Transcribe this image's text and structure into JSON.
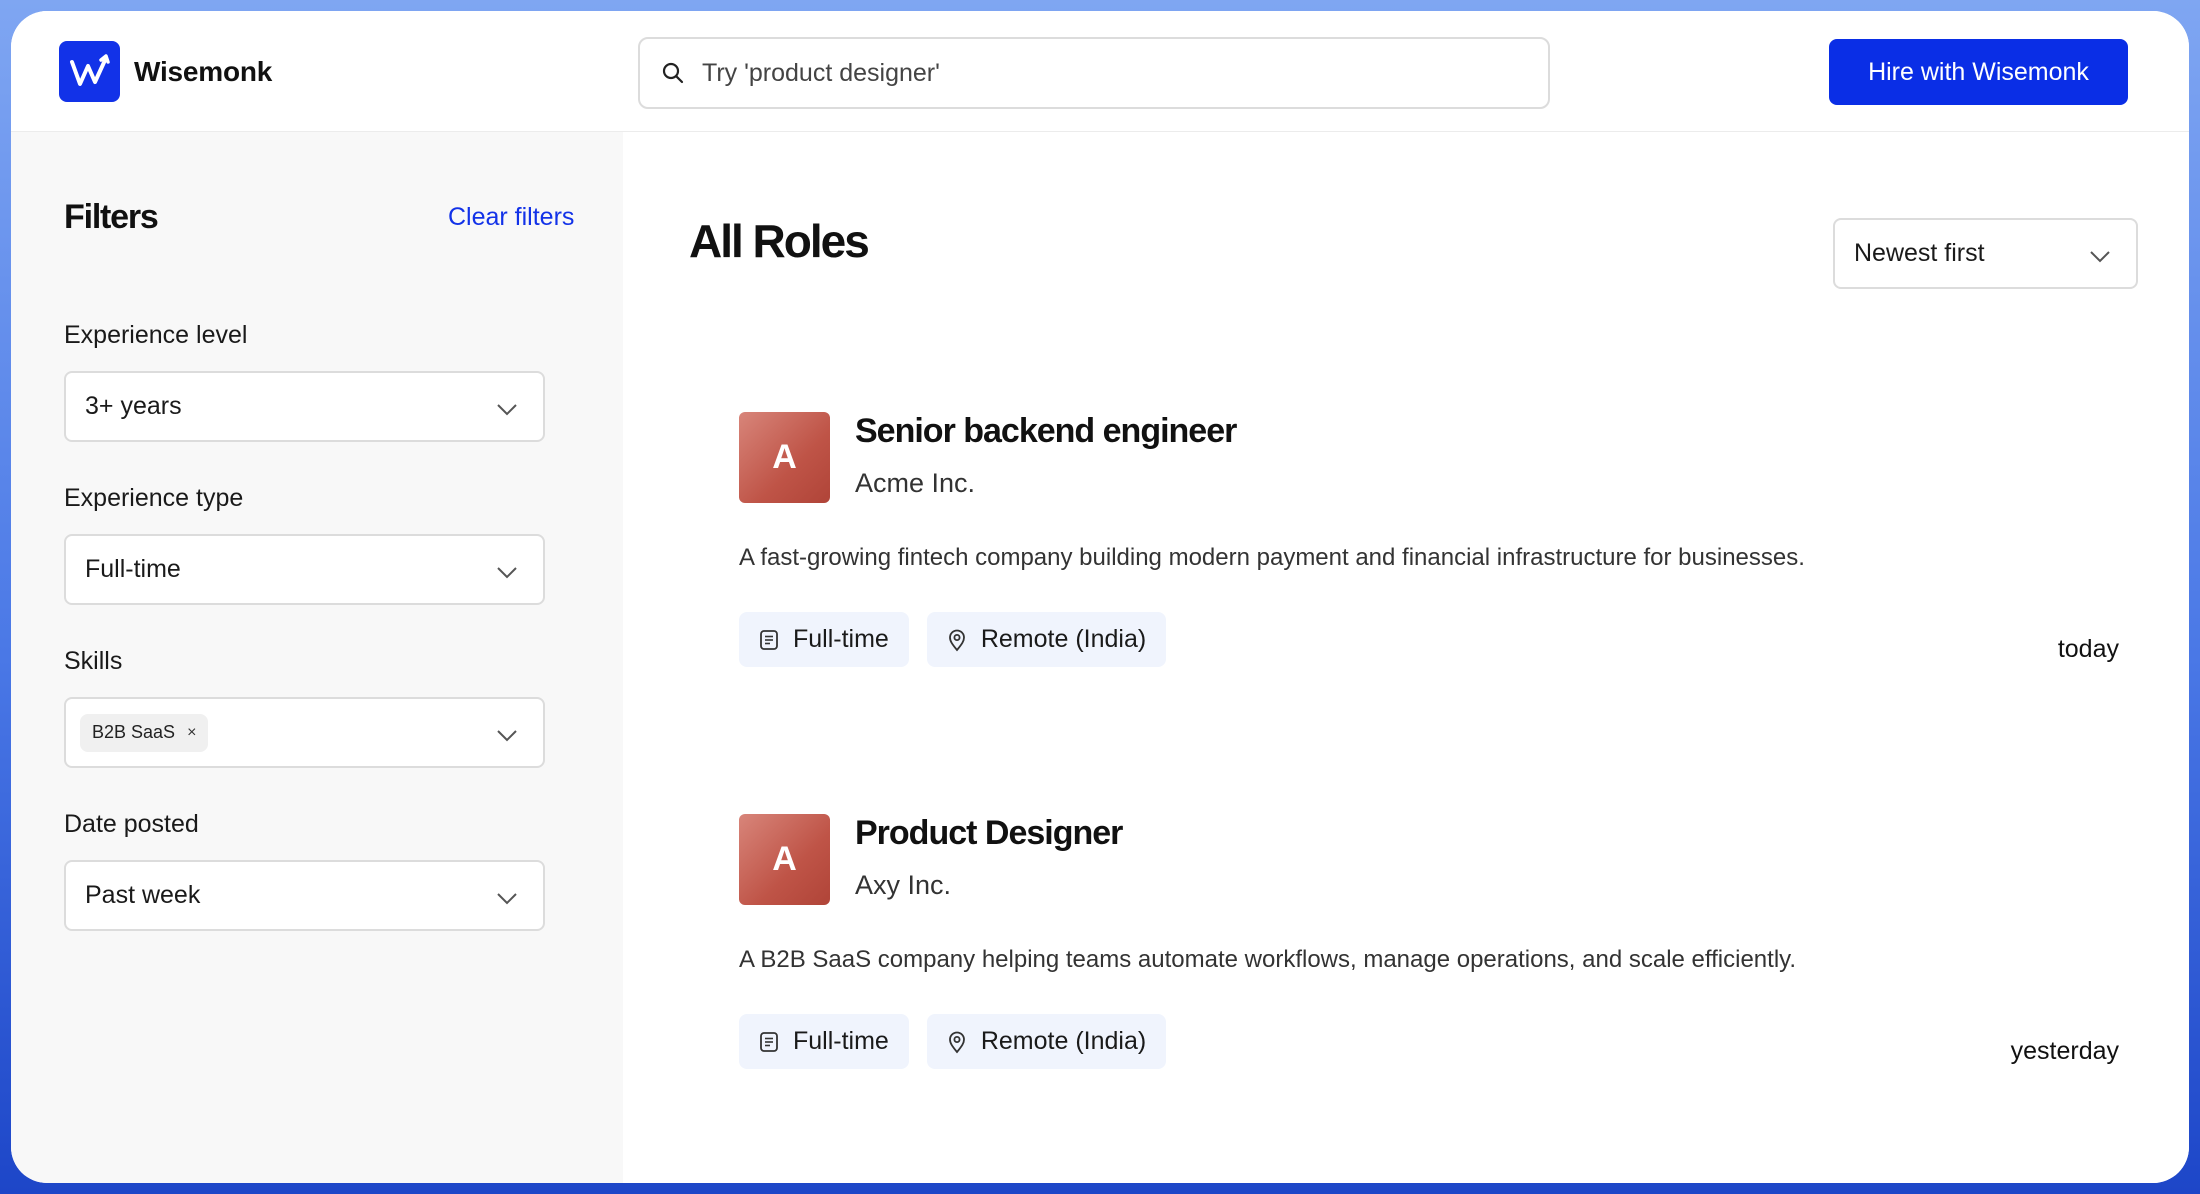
{
  "header": {
    "brand": "Wisemonk",
    "search_placeholder": "Try 'product designer'",
    "hire_button": "Hire with Wisemonk"
  },
  "sidebar": {
    "title": "Filters",
    "clear_label": "Clear filters",
    "filters": {
      "experience_level": {
        "label": "Experience level",
        "value": "3+ years"
      },
      "experience_type": {
        "label": "Experience type",
        "value": "Full-time"
      },
      "skills": {
        "label": "Skills",
        "chip": "B2B SaaS",
        "chip_remove": "×"
      },
      "date_posted": {
        "label": "Date posted",
        "value": "Past week"
      }
    }
  },
  "main": {
    "title": "All Roles",
    "sort_value": "Newest first",
    "roles": [
      {
        "avatar_letter": "A",
        "title": "Senior backend engineer",
        "company": "Acme Inc.",
        "description": "A fast-growing fintech company building modern payment and financial infrastructure for businesses.",
        "type": "Full-time",
        "location": "Remote (India)",
        "posted": "today"
      },
      {
        "avatar_letter": "A",
        "title": "Product Designer",
        "company": "Axy Inc.",
        "description": "A B2B SaaS company helping teams automate workflows, manage operations, and scale efficiently.",
        "type": "Full-time",
        "location": "Remote (India)",
        "posted": "yesterday"
      }
    ]
  },
  "colors": {
    "brand_blue": "#0a2ee6",
    "link_blue": "#1232e8",
    "avatar": "#c55a4d",
    "tag_bg": "#f0f4fd"
  },
  "icons": [
    "wisemonk-logo-icon",
    "search-icon",
    "chevron-down-icon",
    "document-icon",
    "location-pin-icon",
    "close-icon"
  ]
}
